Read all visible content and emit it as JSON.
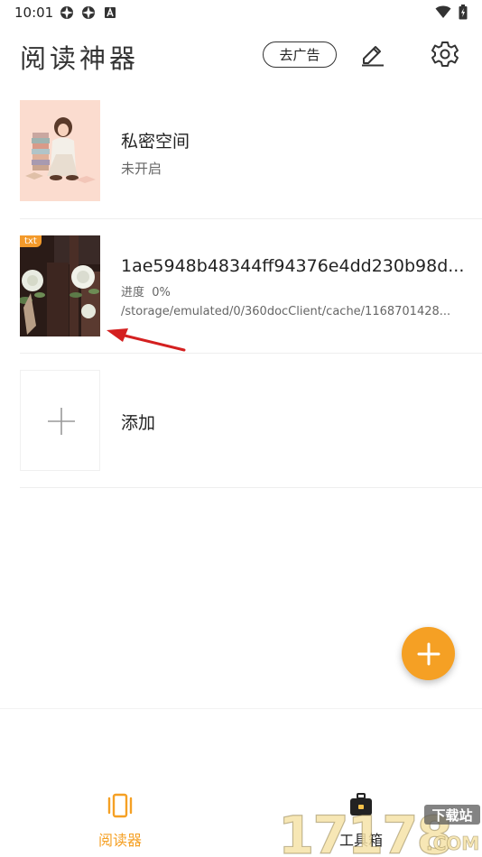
{
  "status_bar": {
    "time": "10:01",
    "left_icons": [
      "app-notification-icon",
      "app-notification-icon",
      "a-letter-icon"
    ],
    "right_icons": [
      "wifi-icon",
      "battery-icon"
    ]
  },
  "header": {
    "title": "阅读神器",
    "ad_button_label": "去广告",
    "edit_icon": "edit-icon",
    "settings_icon": "gear-icon"
  },
  "list": {
    "private": {
      "title": "私密空间",
      "status": "未开启"
    },
    "book": {
      "badge": "txt",
      "title": "1ae5948b48344ff94376e4dd230b98d...",
      "progress_label": "进度",
      "progress_value": "0%",
      "path": "/storage/emulated/0/360docClient/cache/1168701428..."
    },
    "add": {
      "title": "添加"
    }
  },
  "fab": {
    "icon": "plus-icon"
  },
  "bottom_nav": [
    {
      "label": "阅读器",
      "icon": "reader-icon",
      "active": true
    },
    {
      "label": "工具箱",
      "icon": "toolbox-icon",
      "active": false
    }
  ],
  "watermark": {
    "number": "17178",
    "tagline": "下载站",
    "domain": ".COM"
  },
  "colors": {
    "accent": "#f5a024",
    "badge": "#f39a2b",
    "annotation_arrow": "#d42020",
    "text_primary": "#222222",
    "text_secondary": "#666666"
  }
}
